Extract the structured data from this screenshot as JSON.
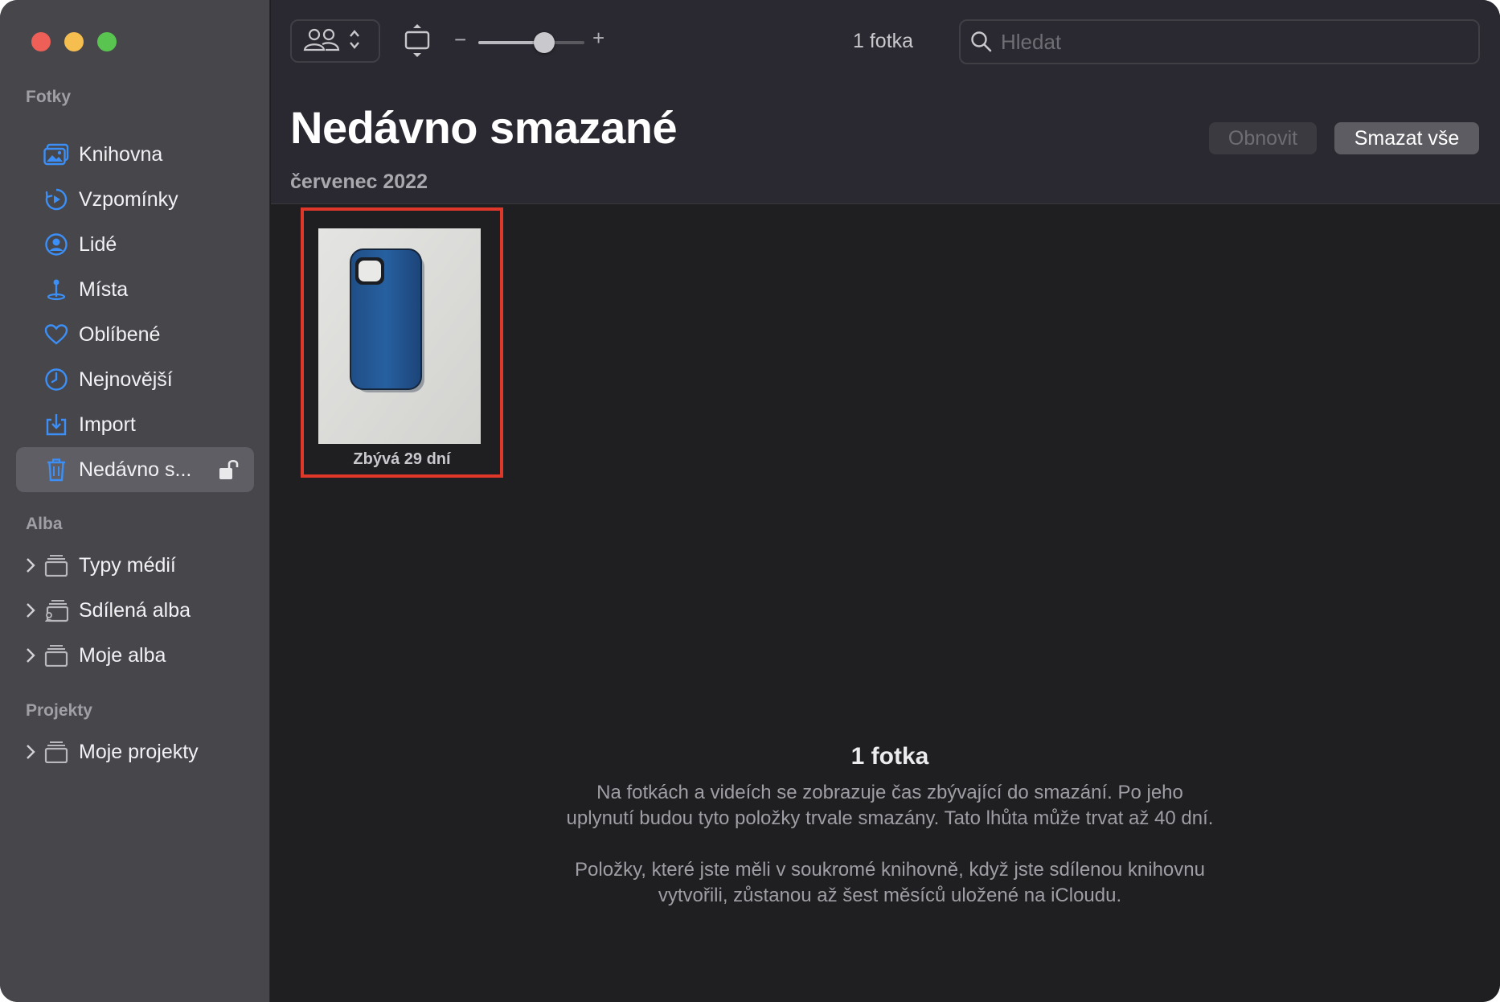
{
  "sidebar": {
    "sections": {
      "photos": "Fotky",
      "albums": "Alba",
      "projects": "Projekty"
    },
    "items": [
      {
        "label": "Knihovna",
        "icon": "library-icon"
      },
      {
        "label": "Vzpomínky",
        "icon": "memories-icon"
      },
      {
        "label": "Lidé",
        "icon": "people-icon"
      },
      {
        "label": "Místa",
        "icon": "places-icon"
      },
      {
        "label": "Oblíbené",
        "icon": "heart-icon"
      },
      {
        "label": "Nejnovější",
        "icon": "clock-icon"
      },
      {
        "label": "Import",
        "icon": "import-icon"
      },
      {
        "label": "Nedávno s...",
        "icon": "trash-icon",
        "selected": true
      }
    ],
    "albums": [
      {
        "label": "Typy médií",
        "icon": "stack-icon"
      },
      {
        "label": "Sdílená alba",
        "icon": "shared-stack-icon"
      },
      {
        "label": "Moje alba",
        "icon": "stack-icon"
      }
    ],
    "projects": [
      {
        "label": "Moje projekty",
        "icon": "stack-icon"
      }
    ]
  },
  "toolbar": {
    "zoom_level": 0.62,
    "count": "1 fotka",
    "search_placeholder": "Hledat"
  },
  "main": {
    "title": "Nedávno smazané",
    "restore_label": "Obnovit",
    "delete_all_label": "Smazat vše",
    "date_header": "červenec 2022",
    "photos": [
      {
        "caption": "Zbývá 29 dní"
      }
    ],
    "info": {
      "title": "1 fotka",
      "paragraph1": "Na fotkách a videích se zobrazuje čas zbývající do smazání. Po jeho uplynutí budou tyto položky trvale smazány. Tato lhůta může trvat až 40 dní.",
      "paragraph2": "Položky, které jste měli v soukromé knihovně, když jste sdílenou knihovnu vytvořili, zůstanou až šest měsíců uložené na iCloudu."
    }
  },
  "colors": {
    "accent_blue": "#3b8ff6",
    "selection_outline": "#e0372b"
  }
}
